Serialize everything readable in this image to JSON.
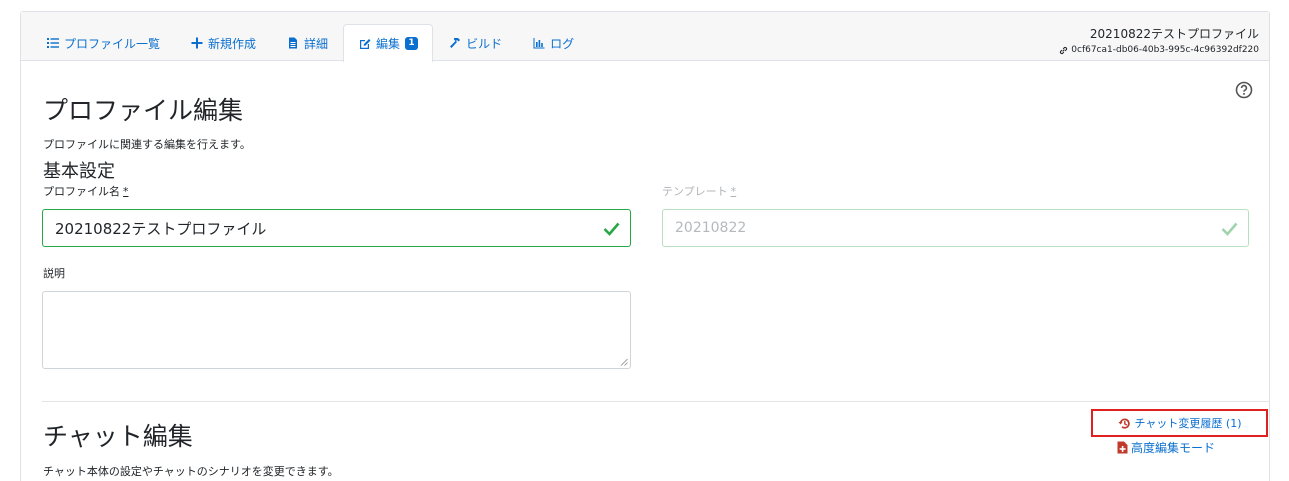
{
  "tabs": [
    {
      "label": "プロファイル一覧",
      "icon": "list-icon"
    },
    {
      "label": "新規作成",
      "icon": "plus-icon"
    },
    {
      "label": "詳細",
      "icon": "file-icon"
    },
    {
      "label": "編集",
      "icon": "edit-icon",
      "badge": "1",
      "active": true
    },
    {
      "label": "ビルド",
      "icon": "hammer-icon"
    },
    {
      "label": "ログ",
      "icon": "bar-chart-icon"
    }
  ],
  "profile": {
    "name": "20210822テストプロファイル",
    "uuid": "0cf67ca1-db06-40b3-995c-4c96392df220"
  },
  "page": {
    "title": "プロファイル編集",
    "description": "プロファイルに関連する編集を行えます。",
    "section_title": "基本設定"
  },
  "form": {
    "profile_name_label": "プロファイル名",
    "profile_name_value": "20210822テストプロファイル",
    "template_label": "テンプレート",
    "template_value": "20210822",
    "required_mark": "*",
    "description_label": "説明",
    "description_value": ""
  },
  "chat": {
    "title": "チャット編集",
    "description": "チャット本体の設定やチャットのシナリオを変更できます。",
    "history_link": "チャット変更履歴 (1)",
    "advanced_link": "高度編集モード"
  },
  "colors": {
    "link": "#0a6fcf",
    "valid": "#28a745",
    "highlight": "#e02020",
    "danger_icon": "#c0392b"
  }
}
